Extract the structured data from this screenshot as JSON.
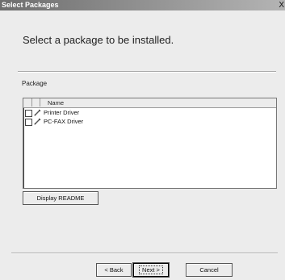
{
  "window": {
    "title": "Select Packages",
    "close_glyph": "X"
  },
  "header": {
    "heading": "Select a package to be installed."
  },
  "package_section": {
    "label": "Package",
    "column_name": "Name",
    "items": [
      {
        "label": "Printer Driver",
        "icon": "pencil-icon",
        "checked": false
      },
      {
        "label": "PC-FAX Driver",
        "icon": "pencil-icon",
        "checked": false
      }
    ]
  },
  "buttons": {
    "display_readme": "Display README",
    "back": "< Back",
    "next": "Next >",
    "cancel": "Cancel"
  }
}
